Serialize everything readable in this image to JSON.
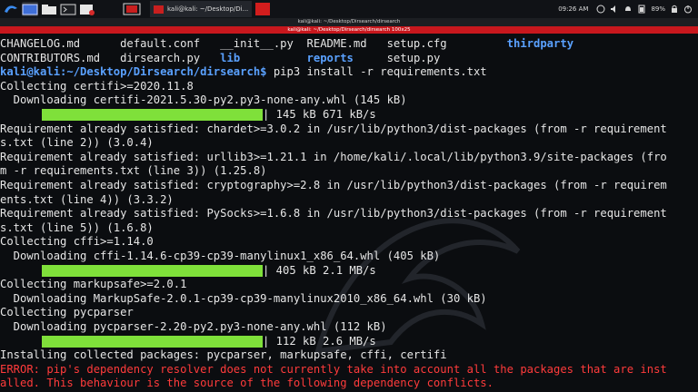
{
  "taskbar": {
    "task_label": "kali@kali: ~/Desktop/Di...",
    "clock": "09:26 AM",
    "battery": "89%",
    "icons": [
      "kali-menu-icon",
      "desktop-icon",
      "folder-icon",
      "terminal-icon",
      "media-icon",
      "workspace-icon"
    ]
  },
  "window": {
    "title": "kali@kali: ~/Desktop/Dirsearch/dirsearch",
    "subtitle": "kali@kali: ~/Desktop/Dirsearch/dirsearch 100x25"
  },
  "terminal": {
    "lines": [
      {
        "segments": [
          {
            "t": "CHANGELOG.md      default.conf   __init__.py  README.md   setup.cfg         ",
            "c": ""
          },
          {
            "t": "thirdparty",
            "c": "blue"
          }
        ]
      },
      {
        "segments": [
          {
            "t": "CONTRIBUTORS.md   dirsearch.py   ",
            "c": ""
          },
          {
            "t": "lib",
            "c": "blue"
          },
          {
            "t": "          ",
            "c": ""
          },
          {
            "t": "reports",
            "c": "blue"
          },
          {
            "t": "     setup.py",
            "c": ""
          }
        ]
      },
      {
        "segments": [
          {
            "t": "kali@kali:~/Desktop/Dirsearch/dirsearch$",
            "c": "blue"
          },
          {
            "t": " pip3 install -r requirements.txt",
            "c": ""
          }
        ]
      },
      {
        "segments": [
          {
            "t": "Collecting certifi>=2020.11.8",
            "c": ""
          }
        ]
      },
      {
        "segments": [
          {
            "t": "  Downloading certifi-2021.5.30-py2.py3-none-any.whl (145 kB)",
            "c": ""
          }
        ]
      },
      {
        "bar": true,
        "segments": [
          {
            "t": "| 145 kB 671 kB/s",
            "c": ""
          }
        ]
      },
      {
        "segments": [
          {
            "t": "Requirement already satisfied: chardet>=3.0.2 in /usr/lib/python3/dist-packages (from -r requirement",
            "c": ""
          }
        ]
      },
      {
        "segments": [
          {
            "t": "s.txt (line 2)) (3.0.4)",
            "c": ""
          }
        ]
      },
      {
        "segments": [
          {
            "t": "Requirement already satisfied: urllib3>=1.21.1 in /home/kali/.local/lib/python3.9/site-packages (fro",
            "c": ""
          }
        ]
      },
      {
        "segments": [
          {
            "t": "m -r requirements.txt (line 3)) (1.25.8)",
            "c": ""
          }
        ]
      },
      {
        "segments": [
          {
            "t": "Requirement already satisfied: cryptography>=2.8 in /usr/lib/python3/dist-packages (from -r requirem",
            "c": ""
          }
        ]
      },
      {
        "segments": [
          {
            "t": "ents.txt (line 4)) (3.3.2)",
            "c": ""
          }
        ]
      },
      {
        "segments": [
          {
            "t": "Requirement already satisfied: PySocks>=1.6.8 in /usr/lib/python3/dist-packages (from -r requirement",
            "c": ""
          }
        ]
      },
      {
        "segments": [
          {
            "t": "s.txt (line 5)) (1.6.8)",
            "c": ""
          }
        ]
      },
      {
        "segments": [
          {
            "t": "Collecting cffi>=1.14.0",
            "c": ""
          }
        ]
      },
      {
        "segments": [
          {
            "t": "  Downloading cffi-1.14.6-cp39-cp39-manylinux1_x86_64.whl (405 kB)",
            "c": ""
          }
        ]
      },
      {
        "bar": true,
        "segments": [
          {
            "t": "| 405 kB 2.1 MB/s",
            "c": ""
          }
        ]
      },
      {
        "segments": [
          {
            "t": "Collecting markupsafe>=2.0.1",
            "c": ""
          }
        ]
      },
      {
        "segments": [
          {
            "t": "  Downloading MarkupSafe-2.0.1-cp39-cp39-manylinux2010_x86_64.whl (30 kB)",
            "c": ""
          }
        ]
      },
      {
        "segments": [
          {
            "t": "Collecting pycparser",
            "c": ""
          }
        ]
      },
      {
        "segments": [
          {
            "t": "  Downloading pycparser-2.20-py2.py3-none-any.whl (112 kB)",
            "c": ""
          }
        ]
      },
      {
        "bar": true,
        "segments": [
          {
            "t": "| 112 kB 2.6 MB/s",
            "c": ""
          }
        ]
      },
      {
        "segments": [
          {
            "t": "Installing collected packages: pycparser, markupsafe, cffi, certifi",
            "c": ""
          }
        ]
      },
      {
        "segments": [
          {
            "t": "ERROR: pip's dependency resolver does not currently take into account all the packages that are inst",
            "c": "red"
          }
        ]
      },
      {
        "segments": [
          {
            "t": "alled. This behaviour is the source of the following dependency conflicts.",
            "c": "red"
          }
        ]
      }
    ]
  }
}
